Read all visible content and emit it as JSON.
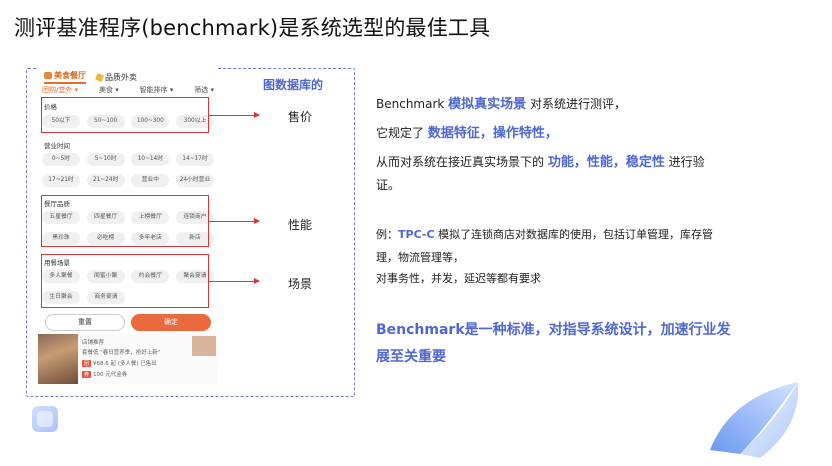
{
  "title": "测评基准程序(benchmark)是系统选型的最佳工具",
  "phone": {
    "tab_food": "美食餐厅",
    "tab_deli": "品质外卖",
    "filters": [
      "团购/堂外 ▾",
      "美食 ▾",
      "智能排序 ▾",
      "筛选 ▾"
    ],
    "price_label": "价格",
    "price_chips": [
      "50以下",
      "50~100",
      "100~300",
      "300以上"
    ],
    "hours_label": "营业时间",
    "hours_row1": [
      "0~5时",
      "5~10时",
      "10~14时",
      "14~17时"
    ],
    "hours_row2": [
      "17~21时",
      "21~24时",
      "营业中",
      "24小时营业"
    ],
    "rest_label": "餐厅品质",
    "rest_row1": [
      "五星餐厅",
      "四星餐厅",
      "上榜餐厅",
      "连锁商户"
    ],
    "rest_row2": [
      "黑珍珠",
      "必吃榜",
      "多年老店",
      "新店"
    ],
    "scene_label": "用餐场景",
    "scene_row1": [
      "多人聚餐",
      "闺蜜小聚",
      "约会餐厅",
      "聚会宴请"
    ],
    "scene_row2": [
      "生日聚会",
      "商务宴请"
    ],
    "reset": "重置",
    "confirm": "确定",
    "behind_line1": "店铺推荐",
    "behind_line2": "套餐低 \"春日营养季，抢好上新\"",
    "behind_line3": "¥68.6 起 (多人餐) 已售出",
    "behind_line4": "100 元代金券"
  },
  "annotations": {
    "db_label": "图数据库的",
    "price": "售价",
    "performance": "性能",
    "scene": "场景"
  },
  "text": {
    "p1_a": "Benchmark ",
    "p1_hl": "模拟真实场景",
    "p1_b": " 对系统进行测评，",
    "p2_a": "它规定了 ",
    "p2_hl": "数据特征，操作特性，",
    "p3_a": "从而对系统在接近真实场景下的 ",
    "p3_hl": "功能，性能，稳定性",
    "p3_b": " 进行验",
    "p4": "证。",
    "ex1_a": "例：",
    "ex1_hl": "TPC-C",
    "ex1_b": " 模拟了连锁商店对数据库的使用，包括订单管理，库存管",
    "ex2": "理，物流管理等，",
    "ex3": "对事务性，并发，延迟等都有要求",
    "big1": "Benchmark是一种标准，对指导系统设计，加速行业发",
    "big2": "展至关重要"
  },
  "colors": {
    "accent_blue": "#4f67d0",
    "red": "#d6333a",
    "orange": "#ea6a3e"
  }
}
